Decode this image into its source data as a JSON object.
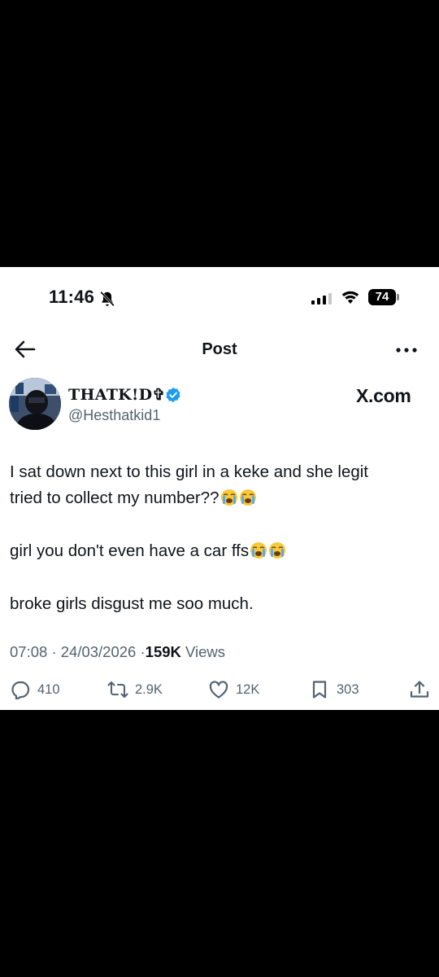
{
  "status_bar": {
    "time": "11:46",
    "battery": "74"
  },
  "nav": {
    "title": "Post"
  },
  "author": {
    "display_name": "THATK!D✞",
    "handle": "@Hesthatkid1",
    "watermark": "X.com"
  },
  "tweet": {
    "lines": [
      "I sat down next to this girl in a keke and she legit",
      "tried to collect my number??",
      "girl you don't even have a car ffs",
      "broke girls disgust me soo much."
    ],
    "emoji": "crying-face"
  },
  "meta": {
    "time": "07:08",
    "sep1": "·",
    "date": "24/03/2026",
    "sep2": "·",
    "views_count": "159K",
    "views_label": "Views"
  },
  "actions": {
    "replies": "410",
    "reposts": "2.9K",
    "likes": "12K",
    "bookmarks": "303"
  },
  "colors": {
    "secondary_text": "#536471",
    "verified_blue": "#1d9bf0",
    "text": "#0f1419"
  }
}
